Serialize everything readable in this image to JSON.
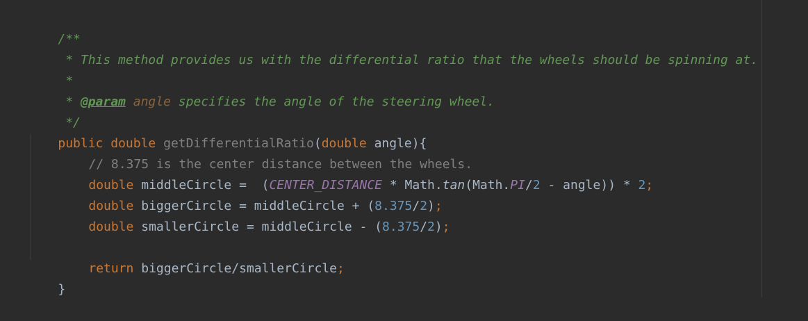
{
  "editor": {
    "language": "java",
    "colors": {
      "background": "#2b2b2b",
      "doc_comment": "#629755",
      "keyword": "#cc7832",
      "number": "#6897bb",
      "constant": "#9876aa",
      "line_comment": "#808080",
      "text": "#a9b7c6"
    },
    "lines": {
      "l1": {
        "doc_open": "/**"
      },
      "l2": {
        "doc_text": " * This method provides us with the differential ratio that the wheels should be spinning at."
      },
      "l3": {
        "doc_text": " *"
      },
      "l4": {
        "doc_star": " * ",
        "tag": "@param",
        "param_name": "angle",
        "doc_text": " specifies the angle of the steering wheel."
      },
      "l5": {
        "doc_close": " */"
      },
      "l6": {
        "kw_public": "public",
        "kw_double": "double",
        "method_name": "getDifferentialRatio",
        "paren_open": "(",
        "param_type": "double",
        "param_name": "angle",
        "paren_close_brace": "){"
      },
      "l7": {
        "comment": "// 8.375 is the center distance between the wheels."
      },
      "l8": {
        "type": "double",
        "var_assign": " middleCircle =  (",
        "constant": "CENTER_DISTANCE",
        "mid1": " * Math.",
        "method": "tan",
        "mid2": "(Math.",
        "pi": "PI",
        "slash": "/",
        "two1": "2",
        "mid3": " - angle)) * ",
        "two2": "2",
        "semi": ";"
      },
      "l9": {
        "type": "double",
        "var_assign": " biggerCircle = middleCircle + (",
        "num": "8.375",
        "slash": "/",
        "two": "2",
        "close": ")",
        "semi": ";"
      },
      "l10": {
        "type": "double",
        "var_assign": " smallerCircle = middleCircle - (",
        "num": "8.375",
        "slash": "/",
        "two": "2",
        "close": ")",
        "semi": ";"
      },
      "l12": {
        "kw_return": "return",
        "expr": " biggerCircle/smallerCircle",
        "semi": ";"
      },
      "l13": {
        "brace": "}"
      }
    }
  }
}
